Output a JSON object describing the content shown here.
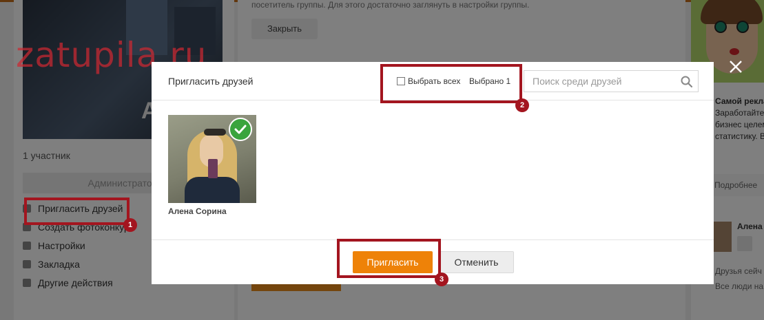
{
  "background": {
    "members_count": "1 участник",
    "admin_label": "Администратор",
    "menu": [
      {
        "label": "Пригласить друзей",
        "icon": "people-icon"
      },
      {
        "label": "Создать фотоконкурс",
        "icon": "camera-icon"
      },
      {
        "label": "Настройки",
        "icon": "gear-icon"
      },
      {
        "label": "Закладка",
        "icon": "bookmark-icon"
      },
      {
        "label": "Другие действия",
        "icon": "triangle-down-icon"
      }
    ],
    "notice_text": "посетитель группы. Для этого достаточно заглянуть в настройки группы.",
    "close_label": "Закрыть",
    "cover_text": "AV",
    "ad": {
      "title": "Самой реклам",
      "lines": [
        "Заработайте напр",
        "бизнес целем. Получ",
        "статистику. Вы"
      ],
      "more": "Подробнее"
    },
    "friend_suggest_name": "Алена",
    "friends_seen": "Друзья сейч",
    "all_people": "Все люди на"
  },
  "watermark": "zatupila.ru",
  "modal": {
    "title": "Пригласить друзей",
    "select_all_label": "Выбрать всех",
    "selected_count": "Выбрано 1",
    "search_placeholder": "Поиск среди друзей",
    "search_value": "",
    "friends": [
      {
        "name": "Алена Сорина",
        "selected": true
      }
    ],
    "invite_label": "Пригласить",
    "cancel_label": "Отменить"
  },
  "annotations": [
    "1",
    "2",
    "3"
  ],
  "colors": {
    "accent": "#ee8208",
    "highlight": "#a3151f",
    "check": "#3aa43d"
  }
}
